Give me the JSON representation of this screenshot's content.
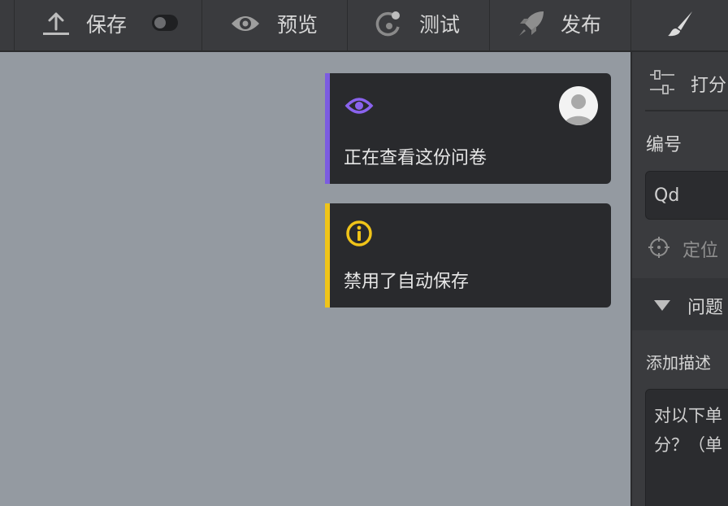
{
  "toolbar": {
    "save_label": "保存",
    "preview_label": "预览",
    "test_label": "测试",
    "publish_label": "发布"
  },
  "notifications": [
    {
      "icon": "eye-icon",
      "accent": "#7c5ce0",
      "message": "正在查看这份问卷"
    },
    {
      "icon": "info-icon",
      "accent": "#f0c419",
      "message": "禁用了自动保存"
    }
  ],
  "panel": {
    "scoring_label": "打分",
    "id_label": "编号",
    "id_value": "Qd",
    "locate_label": "定位",
    "question_section_label": "问题",
    "add_description_label": "添加描述",
    "description_text": "对以下单\n分？（单"
  }
}
